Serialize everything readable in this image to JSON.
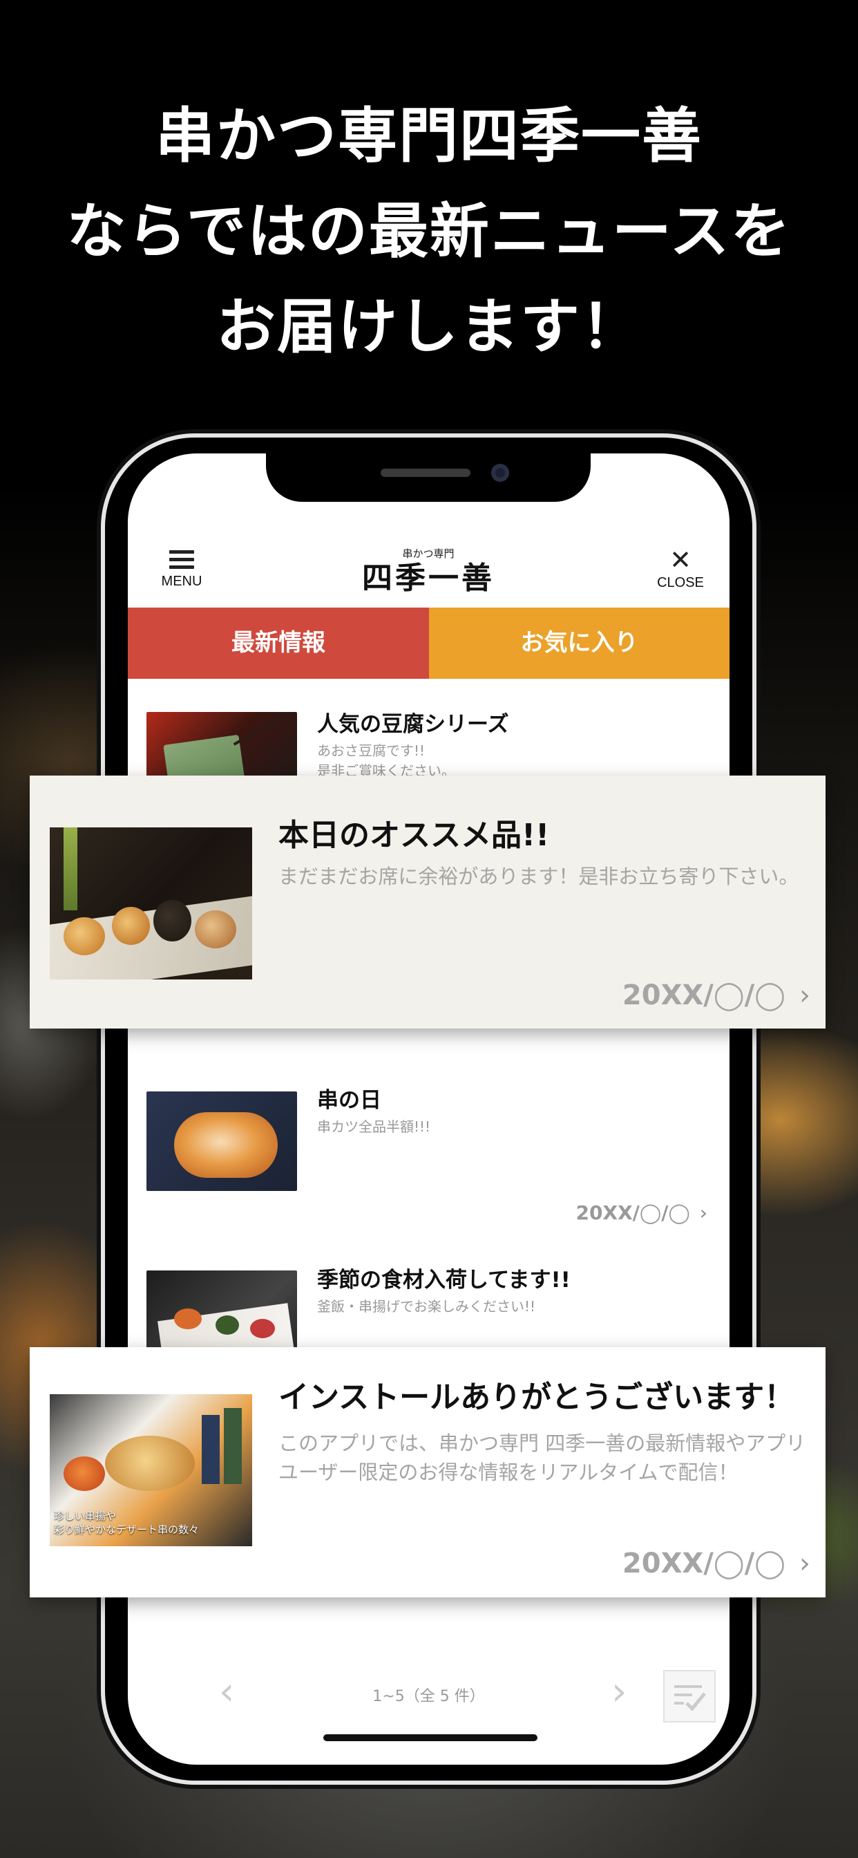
{
  "headline": {
    "line1": "串かつ専門四季一善",
    "line2": "ならではの最新ニュースを",
    "line3": "お届けします！"
  },
  "appbar": {
    "menu_label": "MENU",
    "close_label": "CLOSE",
    "logo_small": "串かつ専門",
    "logo_main": "四季一善"
  },
  "tabs": {
    "news": "最新情報",
    "favorites": "お気に入り"
  },
  "items": [
    {
      "title": "人気の豆腐シリーズ",
      "desc": "あおさ豆腐です!!\n是非ご賞味ください。"
    },
    {
      "title": "串の日",
      "desc": "串カツ全品半額!!!",
      "date": "20XX/◯/◯"
    },
    {
      "title": "季節の食材入荷してます!!",
      "desc": "釜飯・串揚げでお楽しみください!!"
    }
  ],
  "cards": [
    {
      "title": "本日のオススメ品!!",
      "desc": "まだまだお席に余裕があります！是非お立ち寄り下さい。",
      "date": "20XX/◯/◯"
    },
    {
      "title": "インストールありがとうございます！",
      "desc": "このアプリでは、串かつ専門 四季一善の最新情報やアプリユーザー限定のお得な情報をリアルタイムで配信！",
      "date": "20XX/◯/◯",
      "thumb_caption": "珍しい串揚や\n彩り鮮やかなデザート串の数々"
    }
  ],
  "pager": {
    "text": "1~5（全 5 件）"
  },
  "icons": {
    "menu": "hamburger-icon",
    "close": "close-icon",
    "chevron": "chevron-right-icon",
    "prev": "chevron-left-icon",
    "next": "chevron-right-icon",
    "edit": "edit-check-icon"
  },
  "colors": {
    "tab_news": "#cf493d",
    "tab_fav": "#eba12a"
  }
}
